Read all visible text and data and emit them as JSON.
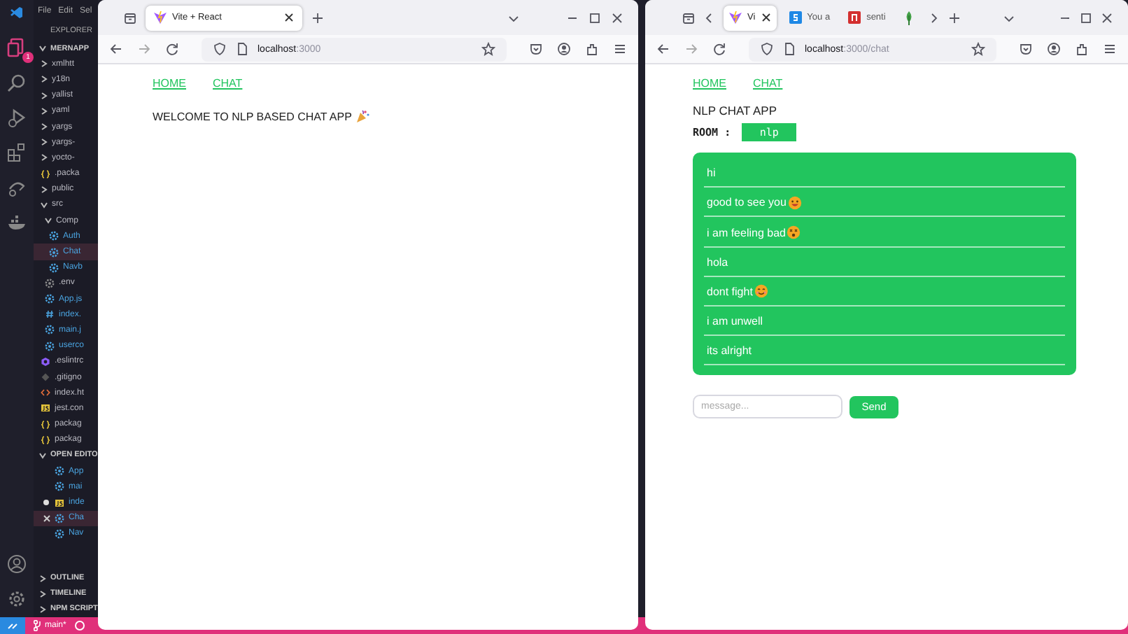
{
  "editor": {
    "menu": [
      "File",
      "Edit",
      "Sel"
    ],
    "badge": "1",
    "explorer_title": "EXPLORER",
    "root": {
      "label": "MERNAPP",
      "expanded": true,
      "children": [
        {
          "label": "xmlhtt",
          "kind": "folder",
          "expanded": false
        },
        {
          "label": "y18n",
          "kind": "folder",
          "expanded": false
        },
        {
          "label": "yallist",
          "kind": "folder",
          "expanded": false
        },
        {
          "label": "yaml",
          "kind": "folder",
          "expanded": false
        },
        {
          "label": "yargs",
          "kind": "folder",
          "expanded": false
        },
        {
          "label": "yargs-",
          "kind": "folder",
          "expanded": false
        },
        {
          "label": "yocto-",
          "kind": "folder",
          "expanded": false
        },
        {
          "label": ".packa",
          "kind": "json",
          "selected": false
        },
        {
          "label": "public",
          "kind": "folder",
          "expanded": false
        },
        {
          "label": "src",
          "kind": "folder",
          "expanded": true,
          "children": [
            {
              "label": "Comp",
              "kind": "folder",
              "expanded": true,
              "children": [
                {
                  "label": "Auth",
                  "kind": "react",
                  "selected": false
                },
                {
                  "label": "Chat",
                  "kind": "react",
                  "selected": true
                },
                {
                  "label": "Navb",
                  "kind": "react",
                  "selected": false
                }
              ]
            },
            {
              "label": ".env",
              "kind": "gear",
              "selected": false
            },
            {
              "label": "App.js",
              "kind": "react",
              "selected": false
            },
            {
              "label": "index.",
              "kind": "css",
              "selected": false
            },
            {
              "label": "main.j",
              "kind": "react",
              "selected": false
            },
            {
              "label": "userco",
              "kind": "react",
              "selected": false
            }
          ]
        },
        {
          "label": ".eslintrc",
          "kind": "eslint",
          "selected": false
        },
        {
          "label": ".gitigno",
          "kind": "git",
          "selected": false
        },
        {
          "label": "index.ht",
          "kind": "html",
          "selected": false
        },
        {
          "label": "jest.con",
          "kind": "js",
          "selected": false
        },
        {
          "label": "packag",
          "kind": "json",
          "selected": false
        },
        {
          "label": "packag",
          "kind": "json",
          "selected": false
        }
      ]
    },
    "open_editors_title": "OPEN EDITO",
    "open_editors": [
      {
        "label": "App",
        "kind": "react",
        "selected": false,
        "modified": false
      },
      {
        "label": "mai",
        "kind": "react",
        "selected": false,
        "modified": false
      },
      {
        "label": "inde",
        "kind": "js",
        "selected": false,
        "modified": true
      },
      {
        "label": "Cha",
        "kind": "react",
        "selected": true,
        "modified": false
      },
      {
        "label": "Nav",
        "kind": "react",
        "selected": false,
        "modified": false
      }
    ],
    "sections": [
      "OUTLINE",
      "TIMELINE",
      "NPM SCRIPT"
    ],
    "branch": "main*"
  },
  "windows": [
    {
      "tabs": [
        {
          "title": "Vite + React",
          "selected": true
        }
      ],
      "url_host": "localhost",
      "url_rest": ":3000",
      "page": {
        "links": [
          "HOME",
          "CHAT"
        ],
        "heading": "WELCOME TO NLP BASED CHAT APP"
      }
    },
    {
      "tabs": [
        {
          "title": "Vi",
          "selected": true
        },
        {
          "title": "You a",
          "selected": false,
          "kind": "s"
        },
        {
          "title": "senti",
          "selected": false,
          "kind": "n"
        },
        {
          "selected": false,
          "kind": "leaf"
        }
      ],
      "url_host": "localhost",
      "url_rest": ":3000/chat",
      "page": {
        "links": [
          "HOME",
          "CHAT"
        ],
        "title": "NLP CHAT APP",
        "room_label": "ROOM :",
        "room": "nlp",
        "messages": [
          {
            "text": "hi"
          },
          {
            "text": "good to see you",
            "kind": "grin"
          },
          {
            "text": "i am feeling bad",
            "kind": "dizzy"
          },
          {
            "text": "hola"
          },
          {
            "text": "dont fight",
            "kind": "smile"
          },
          {
            "text": "i am unwell"
          },
          {
            "text": "its alright"
          }
        ],
        "input": {
          "placeholder": "message..."
        },
        "send": "Send"
      }
    }
  ]
}
